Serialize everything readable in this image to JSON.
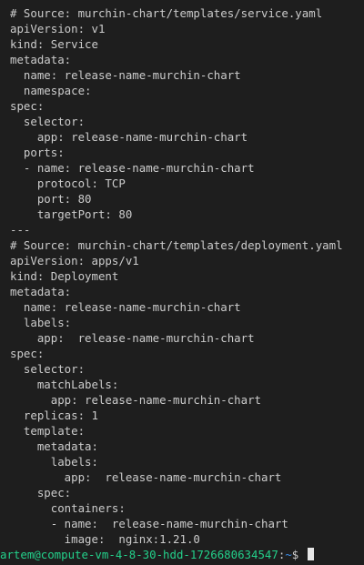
{
  "terminal": {
    "lines": [
      "# Source: murchin-chart/templates/service.yaml",
      "apiVersion: v1",
      "kind: Service",
      "metadata:",
      "  name: release-name-murchin-chart",
      "  namespace:",
      "spec:",
      "  selector:",
      "    app: release-name-murchin-chart",
      "  ports:",
      "  - name: release-name-murchin-chart",
      "    protocol: TCP",
      "    port: 80",
      "    targetPort: 80",
      "---",
      "# Source: murchin-chart/templates/deployment.yaml",
      "apiVersion: apps/v1",
      "kind: Deployment",
      "metadata:",
      "  name: release-name-murchin-chart",
      "  labels:",
      "    app:  release-name-murchin-chart",
      "spec:",
      "  selector:",
      "    matchLabels:",
      "      app: release-name-murchin-chart",
      "  replicas: 1",
      "  template:",
      "    metadata:",
      "      labels:",
      "        app:  release-name-murchin-chart",
      "    spec:",
      "      containers:",
      "      - name:  release-name-murchin-chart",
      "        image:  nginx:1.21.0"
    ],
    "prompt": {
      "user_host": "artem@compute-vm-4-8-30-hdd-1726680634547",
      "colon": ":",
      "path": "~",
      "symbol": "$ "
    },
    "colors": {
      "background": "#1e1e1e",
      "text": "#cccccc",
      "prompt_user": "#23d18b",
      "prompt_path": "#3b8eea"
    }
  }
}
